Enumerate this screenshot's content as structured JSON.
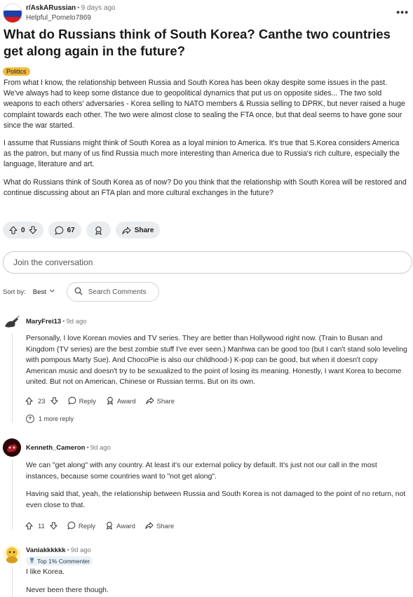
{
  "post": {
    "subreddit": "r/AskARussian",
    "time": "9 days ago",
    "author": "Helpful_Pomelo7869",
    "more_label": "•••",
    "title": "What do Russians think of South Korea? Canthe two countries get along again in the future?",
    "flair": "Politics",
    "body": [
      "From what I know, the relationship between Russia and South Korea has been okay despite some issues in the past. We've always had to keep some distance due to geopolitical dynamics that put us on opposite sides... The two sold weapons to each others' adversaries - Korea selling to NATO members & Russia selling to DPRK, but never raised a huge complaint towards each other. The two were almost close to sealing the FTA once, but that deal seems to have gone sour since the war started.",
      "I assume that Russians might think of South Korea as a loyal minion to America. It's true that S.Korea considers America as the patron, but many of us find Russia much more interesting than America due to Russia's rich culture, especially the language, literature and art.",
      "What do Russians think of South Korea as of now? Do you think that the relationship with South Korea will be restored and continue discussing about an FTA plan and more cultural exchanges in the future?"
    ],
    "votes": "0",
    "comments_count": "67",
    "share_label": "Share"
  },
  "join": {
    "placeholder": "Join the conversation"
  },
  "sort": {
    "label": "Sort by:",
    "value": "Best",
    "search_placeholder": "Search Comments"
  },
  "comments": [
    {
      "author": "MaryFrei13",
      "time": "9d ago",
      "text": [
        "Personally, I love Korean movies and TV series. They are better than Hollywood right now. (Train to Busan and Kingdom (TV series) are the best zombie stuff I've ever seen.) Manhwa can be good too (but I can't stand solo leveling with pompous Marty Sue). And ChocoPie is also our childhood-) K-pop can be good, but when it doesn't copy American music and doesn't try to be sexualized to the point of losing its meaning. Honestly, I want Korea to become united. But not on American, Chinese or Russian terms. But on its own."
      ],
      "votes": "23",
      "reply_label": "Reply",
      "award_label": "Award",
      "share_label": "Share",
      "more_replies": "1 more reply"
    },
    {
      "author": "Kenneth_Cameron",
      "time": "9d ago",
      "text": [
        "We can \"get along\" with any country. At least it's our external policy by default. It's just not our call in the most instances, because some countries want to \"not get along\".",
        "Having said that, yeah, the relationship between Russia and South Korea is not damaged to the point of no return, not even close to that."
      ],
      "votes": "11",
      "reply_label": "Reply",
      "award_label": "Award",
      "share_label": "Share"
    },
    {
      "author": "Vaniakkkkkk",
      "time": "9d ago",
      "badge": "Top 1% Commenter",
      "text": [
        "I like Korea.",
        "Never been there though."
      ]
    }
  ]
}
